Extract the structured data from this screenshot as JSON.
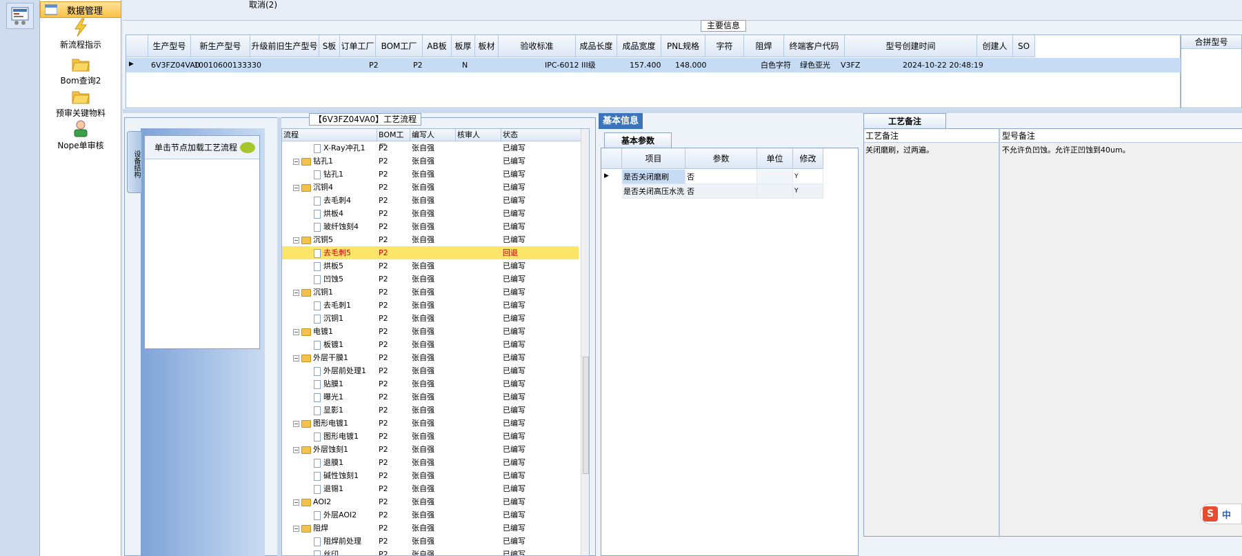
{
  "left_nav": {
    "header": "数据管理",
    "items": [
      "新流程指示",
      "Bom查询2",
      "预审关键物料",
      "Nope单审核"
    ]
  },
  "top": {
    "cancel_label": "取消(2)",
    "main_info_tab": "主要信息"
  },
  "main_grid": {
    "columns": [
      "生产型号",
      "新生产型号",
      "升级前旧生产型号",
      "S板",
      "订单工厂",
      "BOM工厂",
      "AB板",
      "板厚",
      "板材",
      "验收标准",
      "成品长度",
      "成品宽度",
      "PNL规格",
      "字符",
      "阻焊",
      "终端客户代码",
      "型号创建时间",
      "创建人",
      "SO"
    ],
    "row": [
      "6V3FZ04VA0",
      "10010600133330",
      "",
      "P2",
      "P2",
      "",
      "N",
      "",
      "",
      "IPC-6012 III级",
      "157.400",
      "148.000",
      "",
      "白色字符",
      "绿色亚光",
      "V3FZ",
      "2024-10-22 20:48:19",
      "",
      ""
    ],
    "extra_column": "合拼型号"
  },
  "process": {
    "title": "【6V3FZ04VA0】工艺流程",
    "load_hint": "单击节点加载工艺流程",
    "vertical_tab": "设备结构",
    "columns": [
      "流程",
      "BOM工厂",
      "编写人",
      "核审人",
      "状态"
    ],
    "rows": [
      {
        "name": "X-Ray冲孔1",
        "kind": "doc",
        "factory": "P2",
        "writer": "张自强",
        "status": "已编写"
      },
      {
        "name": "钻孔1",
        "kind": "folder",
        "factory": "P2",
        "writer": "张自强",
        "status": "已编写"
      },
      {
        "name": "钻孔1",
        "kind": "doc",
        "factory": "P2",
        "writer": "张自强",
        "status": "已编写"
      },
      {
        "name": "沉铜4",
        "kind": "folder",
        "factory": "P2",
        "writer": "张自强",
        "status": "已编写"
      },
      {
        "name": "去毛刺4",
        "kind": "doc",
        "factory": "P2",
        "writer": "张自强",
        "status": "已编写"
      },
      {
        "name": "烘板4",
        "kind": "doc",
        "factory": "P2",
        "writer": "张自强",
        "status": "已编写"
      },
      {
        "name": "玻纤蚀刻4",
        "kind": "doc",
        "factory": "P2",
        "writer": "张自强",
        "status": "已编写"
      },
      {
        "name": "沉铜5",
        "kind": "folder",
        "factory": "P2",
        "writer": "张自强",
        "status": "已编写"
      },
      {
        "name": "去毛刺5",
        "kind": "doc",
        "factory": "P2",
        "writer": "",
        "status": "回退",
        "highlight": true
      },
      {
        "name": "烘板5",
        "kind": "doc",
        "factory": "P2",
        "writer": "张自强",
        "status": "已编写"
      },
      {
        "name": "凹蚀5",
        "kind": "doc",
        "factory": "P2",
        "writer": "张自强",
        "status": "已编写"
      },
      {
        "name": "沉铜1",
        "kind": "folder",
        "factory": "P2",
        "writer": "张自强",
        "status": "已编写"
      },
      {
        "name": "去毛刺1",
        "kind": "doc",
        "factory": "P2",
        "writer": "张自强",
        "status": "已编写"
      },
      {
        "name": "沉铜1",
        "kind": "doc",
        "factory": "P2",
        "writer": "张自强",
        "status": "已编写"
      },
      {
        "name": "电镀1",
        "kind": "folder",
        "factory": "P2",
        "writer": "张自强",
        "status": "已编写"
      },
      {
        "name": "板镀1",
        "kind": "doc",
        "factory": "P2",
        "writer": "张自强",
        "status": "已编写"
      },
      {
        "name": "外层干膜1",
        "kind": "folder",
        "factory": "P2",
        "writer": "张自强",
        "status": "已编写"
      },
      {
        "name": "外层前处理1",
        "kind": "doc",
        "factory": "P2",
        "writer": "张自强",
        "status": "已编写"
      },
      {
        "name": "贴膜1",
        "kind": "doc",
        "factory": "P2",
        "writer": "张自强",
        "status": "已编写"
      },
      {
        "name": "曝光1",
        "kind": "doc",
        "factory": "P2",
        "writer": "张自强",
        "status": "已编写"
      },
      {
        "name": "显影1",
        "kind": "doc",
        "factory": "P2",
        "writer": "张自强",
        "status": "已编写"
      },
      {
        "name": "图形电镀1",
        "kind": "folder",
        "factory": "P2",
        "writer": "张自强",
        "status": "已编写"
      },
      {
        "name": "图形电镀1",
        "kind": "doc",
        "factory": "P2",
        "writer": "张自强",
        "status": "已编写"
      },
      {
        "name": "外层蚀刻1",
        "kind": "folder",
        "factory": "P2",
        "writer": "张自强",
        "status": "已编写"
      },
      {
        "name": "退膜1",
        "kind": "doc",
        "factory": "P2",
        "writer": "张自强",
        "status": "已编写"
      },
      {
        "name": "碱性蚀刻1",
        "kind": "doc",
        "factory": "P2",
        "writer": "张自强",
        "status": "已编写"
      },
      {
        "name": "退锡1",
        "kind": "doc",
        "factory": "P2",
        "writer": "张自强",
        "status": "已编写"
      },
      {
        "name": "AOI2",
        "kind": "folder",
        "factory": "P2",
        "writer": "张自强",
        "status": "已编写"
      },
      {
        "name": "外层AOI2",
        "kind": "doc",
        "factory": "P2",
        "writer": "张自强",
        "status": "已编写"
      },
      {
        "name": "阻焊",
        "kind": "folder",
        "factory": "P2",
        "writer": "张自强",
        "status": "已编写"
      },
      {
        "name": "阻焊前处理",
        "kind": "doc",
        "factory": "P2",
        "writer": "张自强",
        "status": "已编写"
      },
      {
        "name": "丝印",
        "kind": "doc",
        "factory": "P2",
        "writer": "张自强",
        "status": "已编写"
      }
    ]
  },
  "basic": {
    "tab": "基本信息",
    "param_tab": "基本参数",
    "columns": [
      "项目",
      "参数",
      "单位",
      "修改"
    ],
    "rows": [
      {
        "item": "是否关闭磨刷",
        "value": "否",
        "unit": "",
        "edit": "Y"
      },
      {
        "item": "是否关闭高压水洗",
        "value": "否",
        "unit": "",
        "edit": "Y"
      }
    ]
  },
  "remarks": {
    "tab": "工艺备注",
    "process_label": "工艺备注",
    "process_text": "关闭磨刷，过两遍。",
    "model_label": "型号备注",
    "model_text": "不允许负凹蚀。允许正凹蚀到40um。"
  },
  "ime": {
    "logo": "S",
    "mode": "中"
  }
}
